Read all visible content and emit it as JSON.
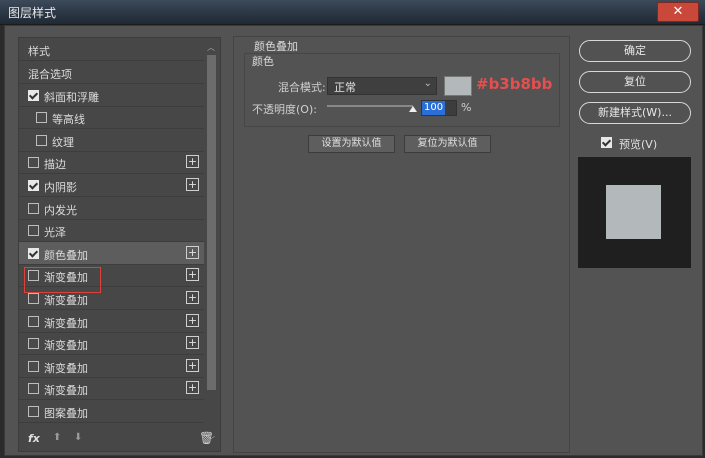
{
  "window": {
    "title": "图层样式",
    "close_glyph": "✕"
  },
  "left_panel": {
    "header": "样式",
    "items": [
      {
        "label": "混合选项",
        "checkbox": null,
        "checked": false,
        "plus": false,
        "indent": false
      },
      {
        "label": "斜面和浮雕",
        "checkbox": true,
        "checked": true,
        "plus": false,
        "indent": false
      },
      {
        "label": "等高线",
        "checkbox": true,
        "checked": false,
        "plus": false,
        "indent": true
      },
      {
        "label": "纹理",
        "checkbox": true,
        "checked": false,
        "plus": false,
        "indent": true
      },
      {
        "label": "描边",
        "checkbox": true,
        "checked": false,
        "plus": true,
        "indent": false
      },
      {
        "label": "内阴影",
        "checkbox": true,
        "checked": true,
        "plus": true,
        "indent": false
      },
      {
        "label": "内发光",
        "checkbox": true,
        "checked": false,
        "plus": false,
        "indent": false
      },
      {
        "label": "光泽",
        "checkbox": true,
        "checked": false,
        "plus": false,
        "indent": false
      },
      {
        "label": "颜色叠加",
        "checkbox": true,
        "checked": true,
        "plus": true,
        "indent": false,
        "selected": true
      },
      {
        "label": "渐变叠加",
        "checkbox": true,
        "checked": false,
        "plus": true,
        "indent": false
      },
      {
        "label": "渐变叠加",
        "checkbox": true,
        "checked": false,
        "plus": true,
        "indent": false
      },
      {
        "label": "渐变叠加",
        "checkbox": true,
        "checked": false,
        "plus": true,
        "indent": false
      },
      {
        "label": "渐变叠加",
        "checkbox": true,
        "checked": false,
        "plus": true,
        "indent": false
      },
      {
        "label": "渐变叠加",
        "checkbox": true,
        "checked": false,
        "plus": true,
        "indent": false
      },
      {
        "label": "渐变叠加",
        "checkbox": true,
        "checked": false,
        "plus": true,
        "indent": false
      },
      {
        "label": "图案叠加",
        "checkbox": true,
        "checked": false,
        "plus": false,
        "indent": false
      }
    ],
    "tools": {
      "fx": "fx",
      "up": "⬆",
      "down": "⬇",
      "trash": "🗑"
    }
  },
  "color_overlay": {
    "group_title": "颜色叠加",
    "sub_title": "颜色",
    "blend_label": "混合模式:",
    "blend_value": "正常",
    "color": "#b3b8bb",
    "color_hex_label": "#b3b8bb",
    "opacity_label": "不透明度(O):",
    "opacity_value": "100",
    "opacity_unit": "%",
    "opacity_fraction": 1.0,
    "set_default": "设置为默认值",
    "reset_default": "复位为默认值"
  },
  "right_panel": {
    "ok": "确定",
    "reset": "复位",
    "new_style": "新建样式(W)...",
    "preview_label": "预览(V)",
    "preview_checked": true
  }
}
